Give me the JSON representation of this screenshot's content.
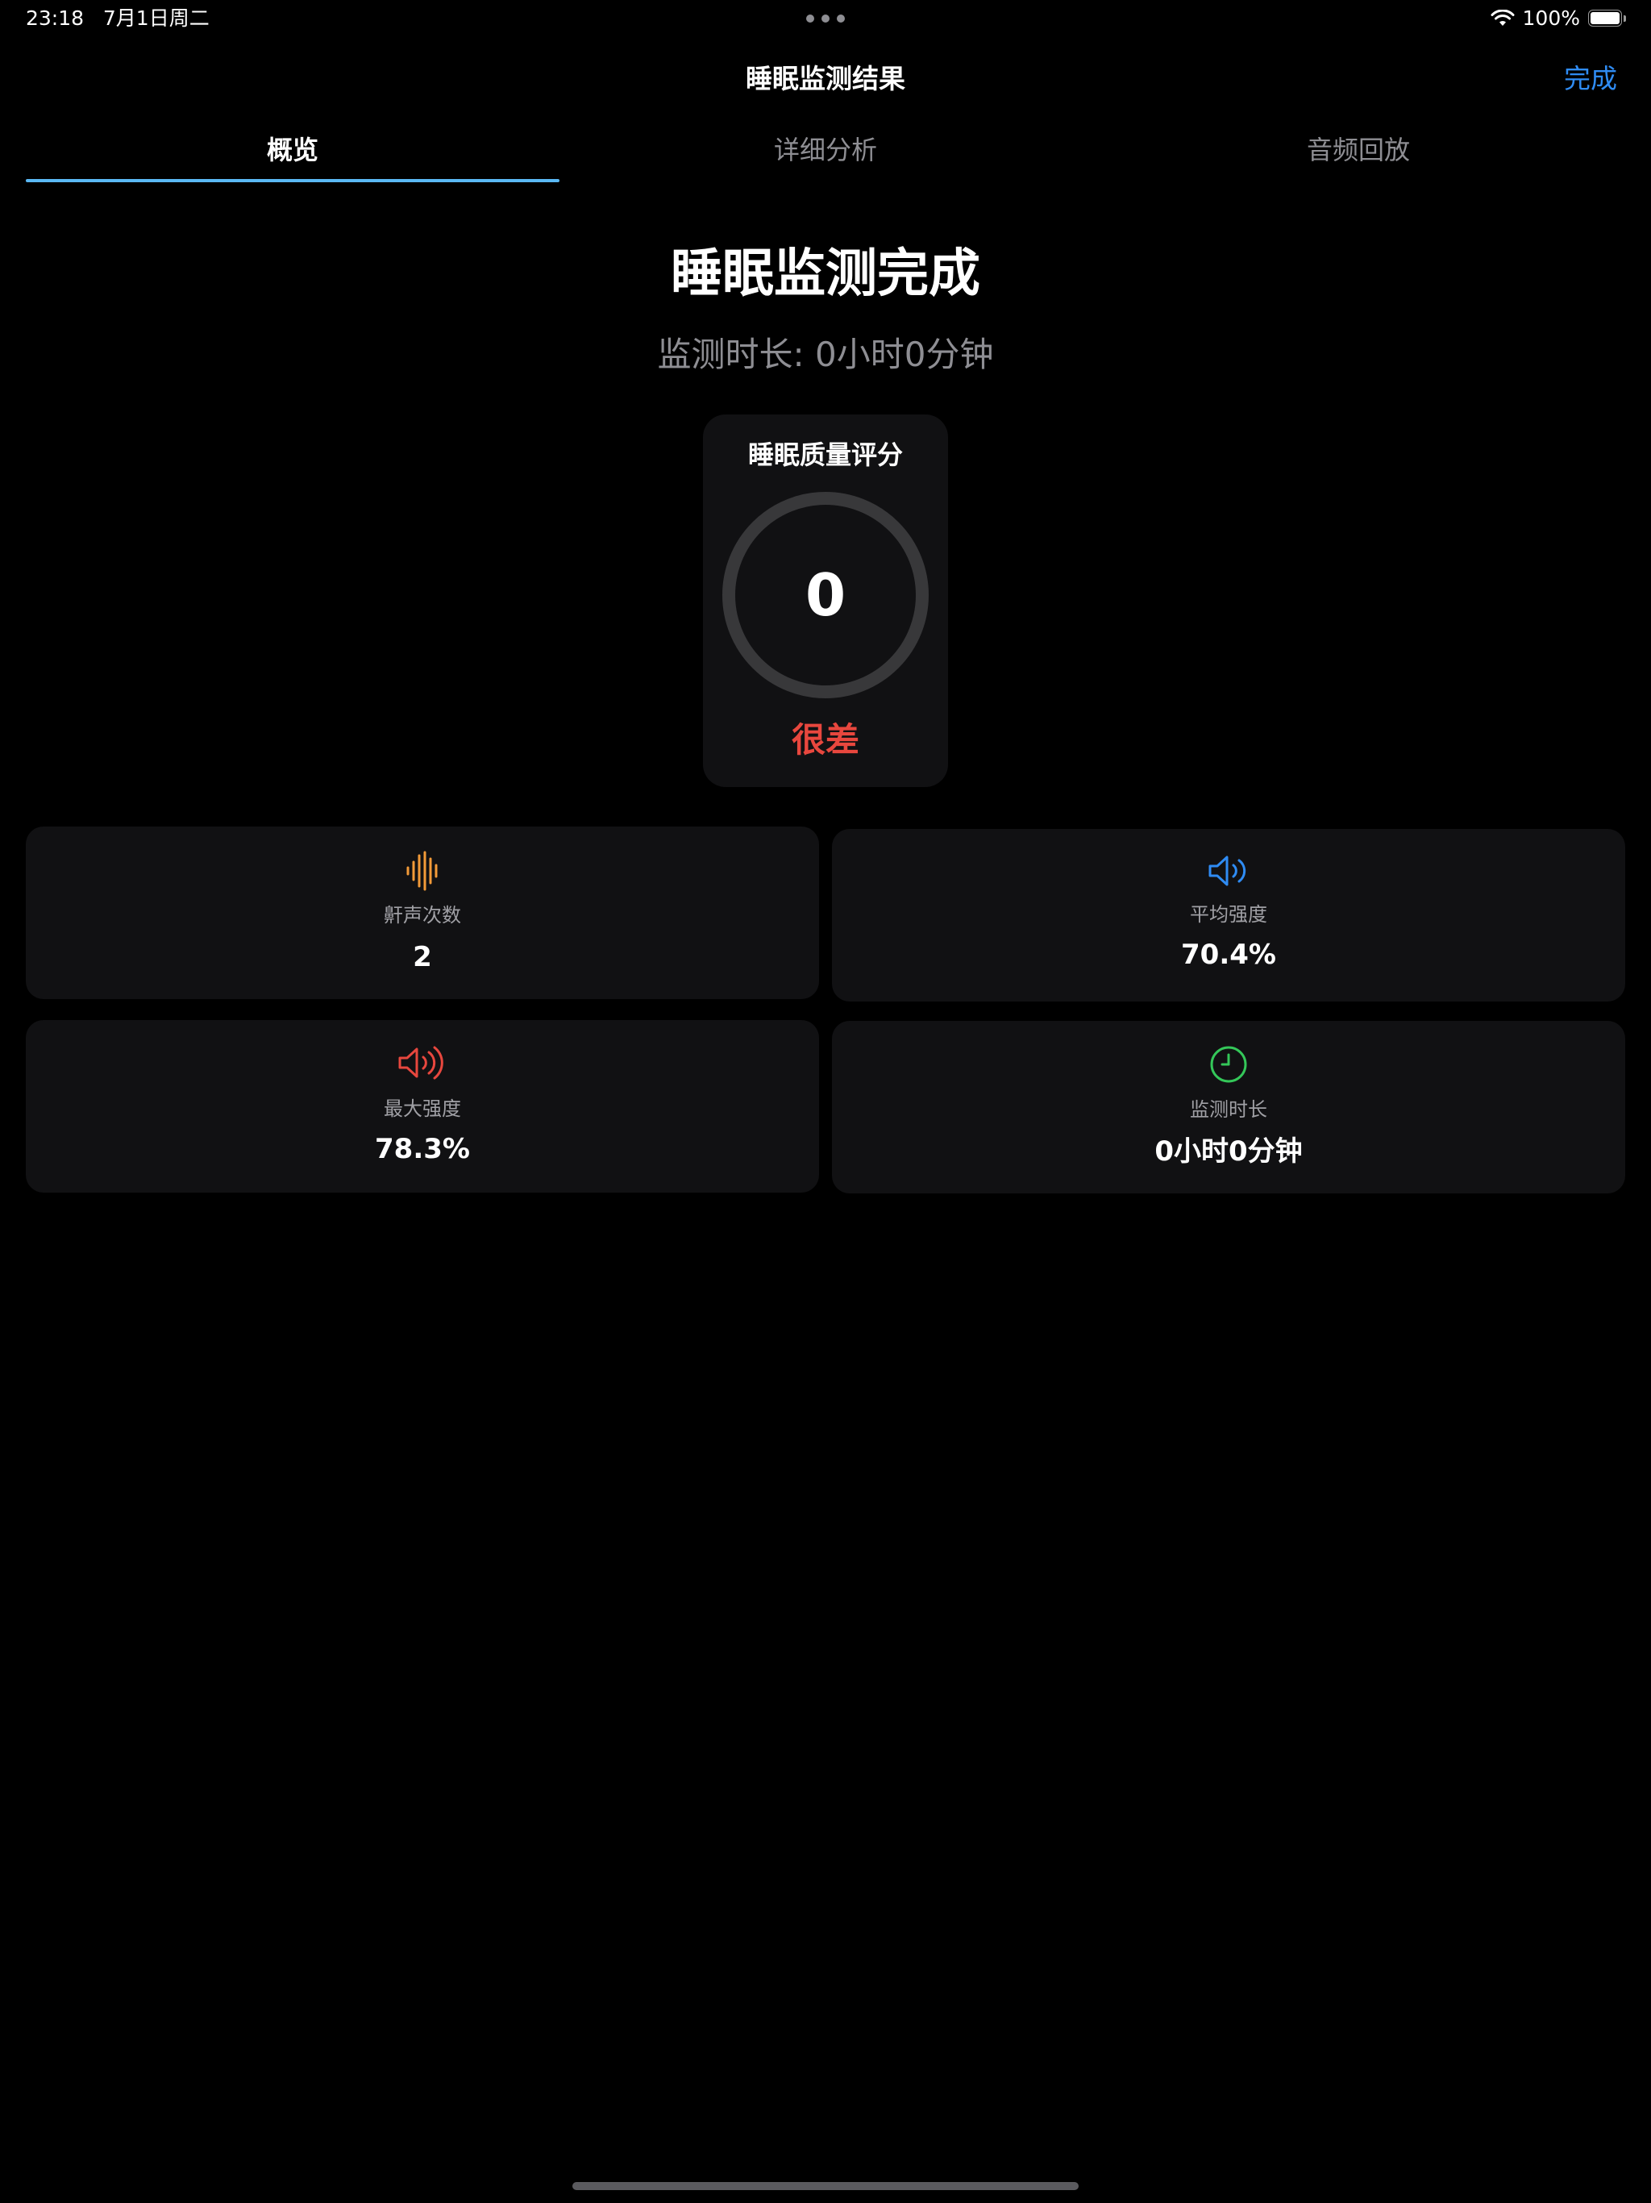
{
  "status_bar": {
    "time": "23:18",
    "date": "7月1日周二",
    "battery": "100%",
    "wifi_icon": "wifi-icon",
    "battery_icon": "battery-full-icon"
  },
  "nav": {
    "title": "睡眠监测结果",
    "done_label": "完成"
  },
  "tabs": [
    {
      "label": "概览",
      "active": true
    },
    {
      "label": "详细分析",
      "active": false
    },
    {
      "label": "音频回放",
      "active": false
    }
  ],
  "summary": {
    "title": "睡眠监测完成",
    "duration_text": "监测时长: 0小时0分钟"
  },
  "score": {
    "title": "睡眠质量评分",
    "value": "0",
    "rating": "很差",
    "rating_color": "#e8473e"
  },
  "stats": [
    {
      "icon": "waveform-icon",
      "color": "#f29a38",
      "label": "鼾声次数",
      "value": "2"
    },
    {
      "icon": "speaker-wave-icon",
      "color": "#2f8cf4",
      "label": "平均强度",
      "value": "70.4%"
    },
    {
      "icon": "speaker-loud-icon",
      "color": "#e8473e",
      "label": "最大强度",
      "value": "78.3%"
    },
    {
      "icon": "clock-icon",
      "color": "#34c759",
      "label": "监测时长",
      "value": "0小时0分钟"
    }
  ],
  "colors": {
    "accent": "#2f8cf4",
    "tab_indicator": "#5ab8f4",
    "card_background": "#111113"
  }
}
